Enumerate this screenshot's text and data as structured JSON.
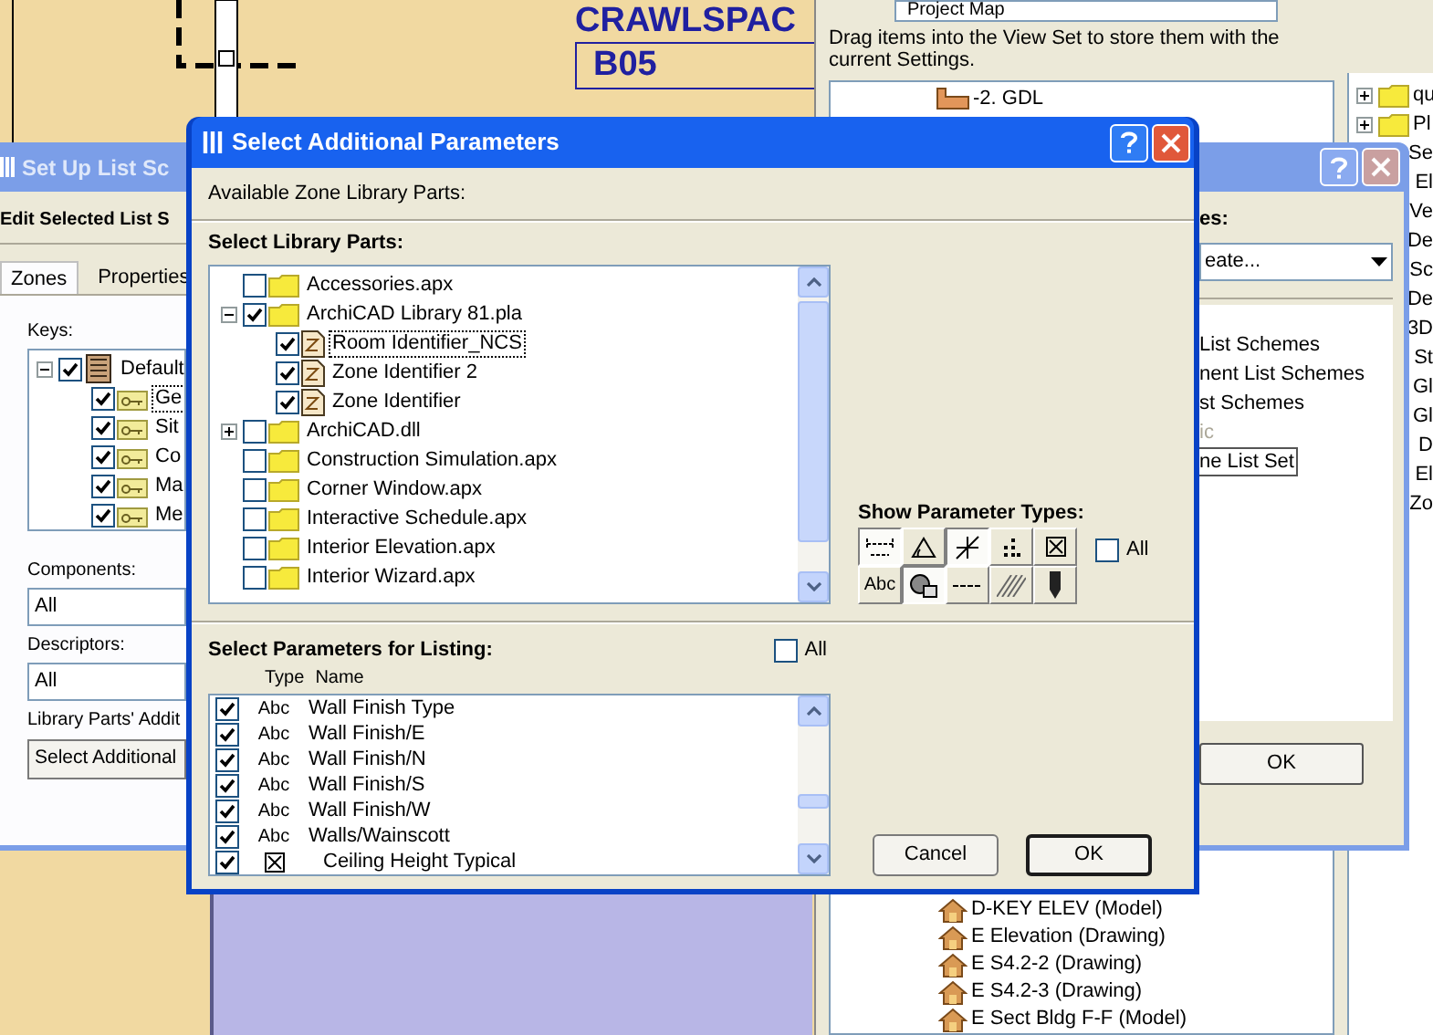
{
  "drawing": {
    "room_name": "CRAWLSPAC",
    "room_number": "B05"
  },
  "navigator": {
    "view_dropdown": "Project Map",
    "hint": "Drag items into the View Set to store them with the current Settings.",
    "top_items": [
      {
        "label": "-2. GDL",
        "kind": "story"
      }
    ],
    "bottom_items": [
      {
        "label": "D-KEY ELEV (Model)",
        "kind": "view"
      },
      {
        "label": "E Elevation (Drawing)",
        "kind": "view"
      },
      {
        "label": "E S4.2-2 (Drawing)",
        "kind": "view"
      },
      {
        "label": "E S4.2-3 (Drawing)",
        "kind": "view"
      },
      {
        "label": "E Sect Bldg F-F (Model)",
        "kind": "view"
      }
    ]
  },
  "view_set_tree": [
    {
      "label": "qu",
      "kind": "folder",
      "expanded": false
    },
    {
      "label": "Pl",
      "kind": "folder",
      "expanded": false
    },
    {
      "label": "Se",
      "kind": "item"
    },
    {
      "label": "El",
      "kind": "item"
    },
    {
      "label": "Ve",
      "kind": "item"
    },
    {
      "label": "De",
      "kind": "item"
    },
    {
      "label": "Sc",
      "kind": "item"
    },
    {
      "label": "De",
      "kind": "item"
    },
    {
      "label": "3D",
      "kind": "item"
    },
    {
      "label": "St",
      "kind": "item"
    },
    {
      "label": "Gl",
      "kind": "item"
    },
    {
      "label": "Gl",
      "kind": "item"
    },
    {
      "label": "D",
      "kind": "item"
    },
    {
      "label": "El",
      "kind": "item"
    },
    {
      "label": "Zo",
      "kind": "item"
    }
  ],
  "list_scheme_window": {
    "title": "Set Up List Sc",
    "heading": "Edit Selected List S",
    "tabs": [
      {
        "label": "Zones",
        "selected": true
      },
      {
        "label": "Properties",
        "selected": false
      }
    ],
    "keys_label": "Keys:",
    "keys": [
      {
        "label": "Default",
        "kind": "set",
        "checked": true,
        "selected": false,
        "expanded": true,
        "children": [
          {
            "label": "Ge",
            "kind": "key",
            "checked": true,
            "selected": true
          },
          {
            "label": "Sit",
            "kind": "key",
            "checked": true,
            "selected": false
          },
          {
            "label": "Co",
            "kind": "key",
            "checked": true,
            "selected": false
          },
          {
            "label": "Ma",
            "kind": "key",
            "checked": true,
            "selected": false
          },
          {
            "label": "Me",
            "kind": "key",
            "checked": true,
            "selected": false
          }
        ]
      }
    ],
    "components_label": "Components:",
    "components": "All",
    "descriptors_label": "Descriptors:",
    "descriptors": "All",
    "library_label": "Library Parts' Addit",
    "library_button": "Select Additional"
  },
  "schemes_window": {
    "label": "es:",
    "dropdown": "eate...",
    "items": [
      {
        "label": "List Schemes",
        "disabled": false,
        "selected": false
      },
      {
        "label": "nent List Schemes",
        "disabled": false,
        "selected": false
      },
      {
        "label": "st Schemes",
        "disabled": false,
        "selected": false
      },
      {
        "label": "ic",
        "disabled": true,
        "selected": false
      },
      {
        "label": "ne List Set",
        "disabled": false,
        "selected": true
      }
    ],
    "ok": "OK"
  },
  "dialog": {
    "title": "Select Additional Parameters",
    "available_label": "Available Zone Library Parts:",
    "library_label": "Select Library Parts:",
    "library_parts": [
      {
        "label": "Accessories.apx",
        "kind": "folder",
        "checked": false,
        "selected": false
      },
      {
        "label": "ArchiCAD Library 81.pla",
        "kind": "folder",
        "checked": true,
        "selected": false,
        "expanded": true,
        "children": [
          {
            "label": "Room Identifier_NCS",
            "kind": "object",
            "checked": true,
            "selected": true
          },
          {
            "label": "Zone Identifier 2",
            "kind": "object",
            "checked": true,
            "selected": false
          },
          {
            "label": "Zone Identifier",
            "kind": "object",
            "checked": true,
            "selected": false
          }
        ]
      },
      {
        "label": "ArchiCAD.dll",
        "kind": "folder",
        "checked": false,
        "selected": false,
        "expanded": false
      },
      {
        "label": "Construction Simulation.apx",
        "kind": "folder",
        "checked": false,
        "selected": false
      },
      {
        "label": "Corner Window.apx",
        "kind": "folder",
        "checked": false,
        "selected": false
      },
      {
        "label": "Interactive Schedule.apx",
        "kind": "folder",
        "checked": false,
        "selected": false
      },
      {
        "label": "Interior Elevation.apx",
        "kind": "folder",
        "checked": false,
        "selected": false
      },
      {
        "label": "Interior Wizard.apx",
        "kind": "folder",
        "checked": false,
        "selected": false
      }
    ],
    "types_label": "Show Parameter Types:",
    "parameter_types": [
      {
        "kind": "dimension",
        "pressed": true
      },
      {
        "kind": "angle",
        "pressed": false
      },
      {
        "kind": "crossing",
        "pressed": true
      },
      {
        "kind": "dots",
        "pressed": false
      },
      {
        "kind": "boolean",
        "pressed": false
      },
      {
        "kind": "text",
        "label": "Abc",
        "pressed": false
      },
      {
        "kind": "fill",
        "pressed": true
      },
      {
        "kind": "line",
        "pressed": false
      },
      {
        "kind": "hatch",
        "pressed": false
      },
      {
        "kind": "pen",
        "pressed": false
      }
    ],
    "types_all": {
      "label": "All",
      "checked": false
    },
    "listing_label": "Select Parameters for Listing:",
    "listing_all": {
      "label": "All",
      "checked": false
    },
    "columns": [
      "Type",
      "Name"
    ],
    "parameters": [
      {
        "checked": true,
        "kind": "text",
        "type": "Abc",
        "name": "Wall Finish Type"
      },
      {
        "checked": true,
        "kind": "text",
        "type": "Abc",
        "name": "Wall Finish/E"
      },
      {
        "checked": true,
        "kind": "text",
        "type": "Abc",
        "name": "Wall Finish/N"
      },
      {
        "checked": true,
        "kind": "text",
        "type": "Abc",
        "name": "Wall Finish/S"
      },
      {
        "checked": true,
        "kind": "text",
        "type": "Abc",
        "name": "Wall Finish/W"
      },
      {
        "checked": true,
        "kind": "text",
        "type": "Abc",
        "name": "Walls/Wainscott"
      },
      {
        "checked": true,
        "kind": "boolean",
        "name": "Ceiling Height Typical"
      }
    ],
    "buttons": [
      {
        "label": "Cancel",
        "default": false
      },
      {
        "label": "OK",
        "default": true
      }
    ]
  }
}
